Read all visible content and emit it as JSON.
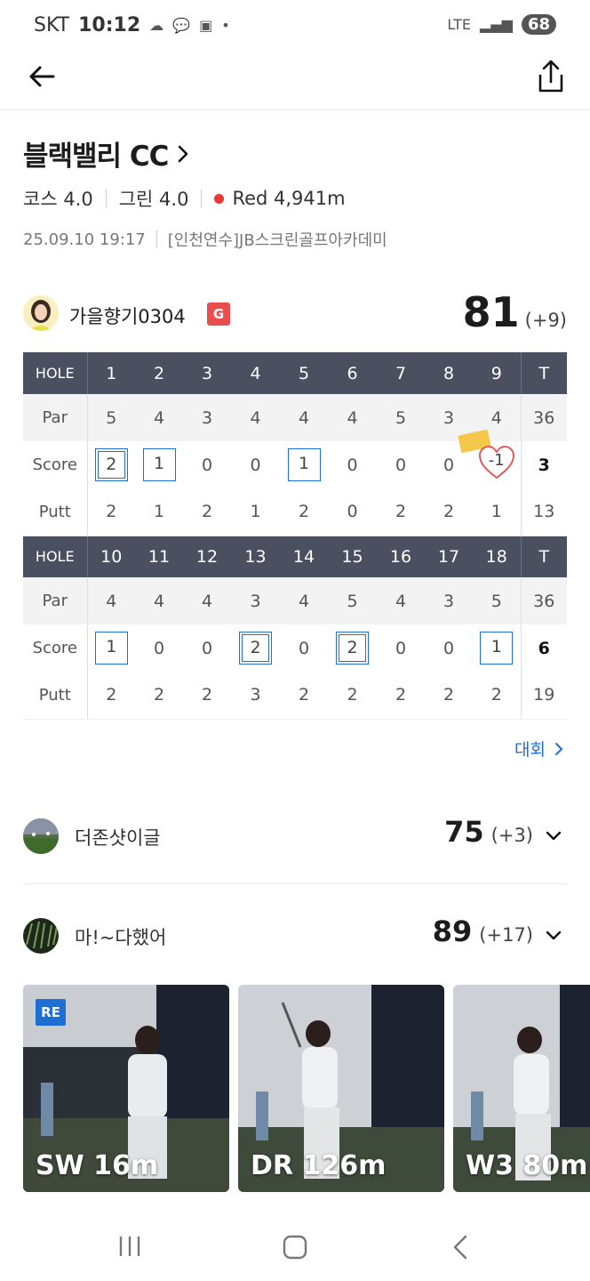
{
  "status": {
    "carrier": "SKT",
    "time": "10:12",
    "battery": "68",
    "network": "LTE"
  },
  "course": {
    "name": "블랙밸리 CC",
    "course_rating": "코스 4.0",
    "green_rating": "그린 4.0",
    "tee": "Red 4,941m",
    "datetime": "25.09.10 19:17",
    "venue": "[인천연수]JB스크린골프아카데미"
  },
  "player": {
    "name": "가을향기0304",
    "badge": "G",
    "score": "81",
    "over": "(+9)"
  },
  "scorecard": {
    "labels": {
      "hole": "HOLE",
      "par": "Par",
      "score": "Score",
      "putt": "Putt",
      "total": "T"
    },
    "front": {
      "holes": [
        "1",
        "2",
        "3",
        "4",
        "5",
        "6",
        "7",
        "8",
        "9"
      ],
      "par": [
        "5",
        "4",
        "3",
        "4",
        "4",
        "4",
        "5",
        "3",
        "4"
      ],
      "score": [
        "2",
        "1",
        "0",
        "0",
        "1",
        "0",
        "0",
        "0",
        "-1"
      ],
      "putt": [
        "2",
        "1",
        "2",
        "1",
        "2",
        "0",
        "2",
        "2",
        "1"
      ],
      "par_total": "36",
      "score_total": "3",
      "putt_total": "13"
    },
    "back": {
      "holes": [
        "10",
        "11",
        "12",
        "13",
        "14",
        "15",
        "16",
        "17",
        "18"
      ],
      "par": [
        "4",
        "4",
        "4",
        "3",
        "4",
        "5",
        "4",
        "3",
        "5"
      ],
      "score": [
        "1",
        "0",
        "0",
        "2",
        "0",
        "2",
        "0",
        "0",
        "1"
      ],
      "putt": [
        "2",
        "2",
        "2",
        "3",
        "2",
        "2",
        "2",
        "2",
        "2"
      ],
      "par_total": "36",
      "score_total": "6",
      "putt_total": "19"
    }
  },
  "contest_link": "대회",
  "others": [
    {
      "name": "더존샷이글",
      "score": "75",
      "over": "(+3)"
    },
    {
      "name": "마!~다했어",
      "score": "89",
      "over": "(+17)"
    }
  ],
  "videos": [
    {
      "label": "SW 16m",
      "badge": "RE"
    },
    {
      "label": "DR 126m"
    },
    {
      "label": "W3 80m"
    }
  ],
  "colors": {
    "accent": "#1e6fd4",
    "header": "#4a5060",
    "tee_dot": "#e53935",
    "badge": "#e94e4e"
  }
}
